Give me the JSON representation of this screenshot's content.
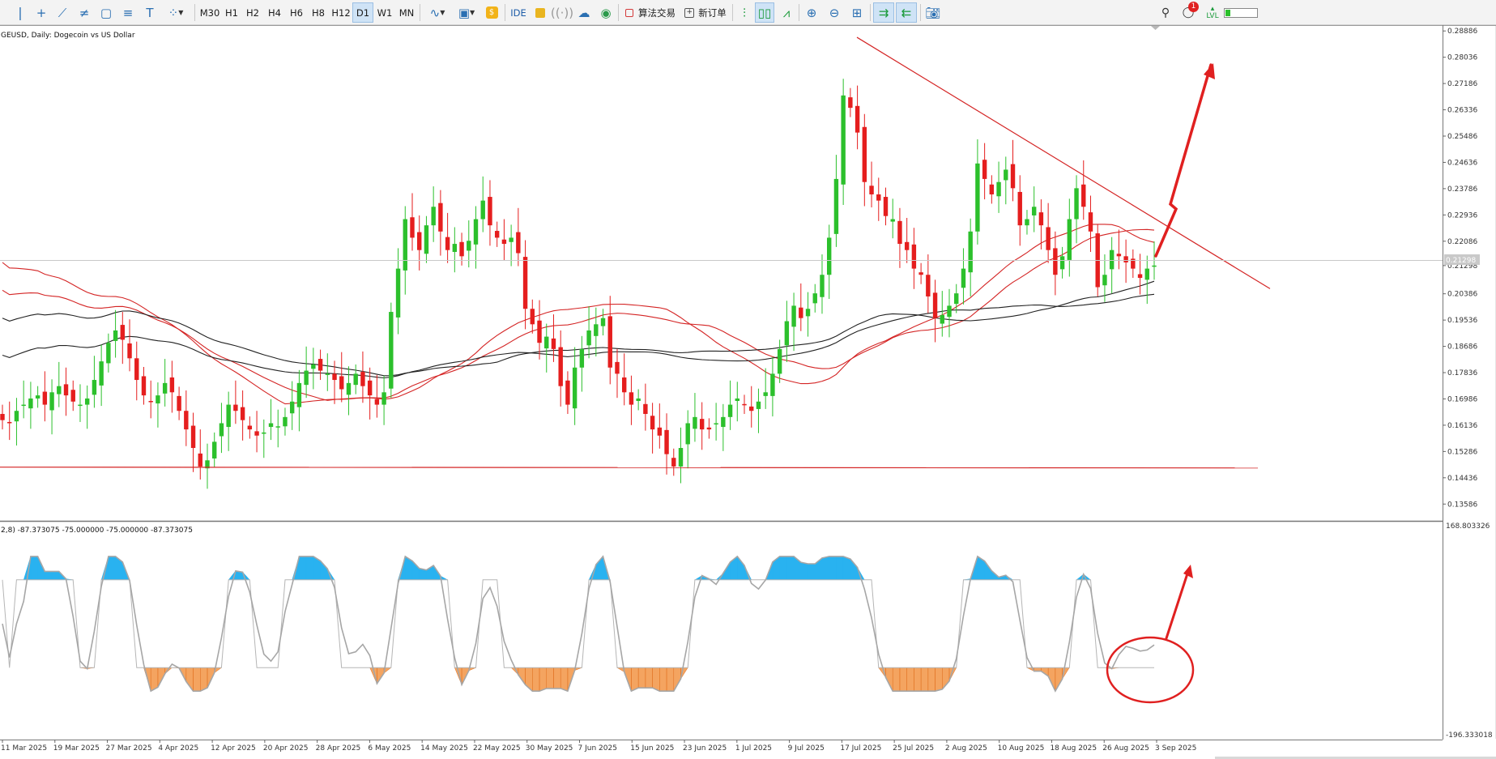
{
  "toolbar": {
    "timeframes": [
      "M30",
      "H1",
      "H2",
      "H4",
      "H6",
      "H8",
      "H12",
      "D1",
      "W1",
      "MN"
    ],
    "active_timeframe": "D1",
    "ide_label": "IDE",
    "algo_trading_label": "算法交易",
    "new_order_label": "新订单",
    "notification_count": "1",
    "icons": [
      "cursor-icon",
      "crosshair-icon",
      "trendline-icon",
      "channel-icon",
      "rectangle-icon",
      "fibonacci-icon",
      "text-icon",
      "shapes-icon",
      "chart-type-icon",
      "template-icon",
      "market-icon",
      "lock-icon",
      "signals-icon",
      "vps-icon",
      "bar-chart-icon",
      "candle-chart-icon",
      "line-chart-icon",
      "zoom-in-icon",
      "zoom-out-icon",
      "grid-icon",
      "autoscroll-icon",
      "shift-icon",
      "screenshot-icon",
      "search-icon",
      "notification-icon",
      "level-icon"
    ]
  },
  "chart": {
    "title": "GEUSD, Daily:  Dogecoin vs US Dollar",
    "current_price_label": "0.21298",
    "indicator_header": "2,8) -87.373075 -75.000000 -75.000000 -87.373075",
    "indicator_top_label": "168.803326",
    "indicator_bottom_label": "-196.333018",
    "colors": {
      "bull": "#2cc02c",
      "bear": "#e51e1e",
      "red_line": "#d42424",
      "blue_fill": "#29b2f0",
      "orange_fill": "#f4a460",
      "gray_line": "#a6a6a6"
    }
  },
  "chart_data": {
    "type": "candlestick",
    "symbol": "Dogecoin vs US Dollar",
    "price_axis": [
      "0.28886",
      "0.28036",
      "0.27186",
      "0.26336",
      "0.25486",
      "0.24636",
      "0.23786",
      "0.22936",
      "0.22086",
      "0.21298",
      "0.20386",
      "0.19536",
      "0.18686",
      "0.17836",
      "0.16986",
      "0.16136",
      "0.15286",
      "0.14436",
      "0.13586"
    ],
    "date_axis": [
      "11 Mar 2025",
      "19 Mar 2025",
      "27 Mar 2025",
      "4 Apr 2025",
      "12 Apr 2025",
      "20 Apr 2025",
      "28 Apr 2025",
      "6 May 2025",
      "14 May 2025",
      "22 May 2025",
      "30 May 2025",
      "7 Jun 2025",
      "15 Jun 2025",
      "23 Jun 2025",
      "1 Jul 2025",
      "9 Jul 2025",
      "17 Jul 2025",
      "25 Jul 2025",
      "2 Aug 2025",
      "10 Aug 2025",
      "18 Aug 2025",
      "26 Aug 2025",
      "3 Sep 2025"
    ],
    "ylim": [
      0.132,
      0.2897
    ],
    "last_price": 0.21298,
    "horizontal_support": 0.1478,
    "downtrend_line": {
      "from": [
        "17 Jul 2025",
        0.2868
      ],
      "to": [
        "after 3 Sep 2025",
        0.2055
      ]
    },
    "closes": [
      0.163,
      0.162,
      0.166,
      0.168,
      0.17,
      0.171,
      0.168,
      0.172,
      0.174,
      0.171,
      0.169,
      0.168,
      0.17,
      0.176,
      0.182,
      0.188,
      0.192,
      0.189,
      0.183,
      0.176,
      0.171,
      0.169,
      0.171,
      0.175,
      0.172,
      0.166,
      0.16,
      0.154,
      0.148,
      0.15,
      0.156,
      0.162,
      0.168,
      0.166,
      0.163,
      0.16,
      0.158,
      0.159,
      0.162,
      0.161,
      0.164,
      0.169,
      0.175,
      0.179,
      0.181,
      0.179,
      0.178,
      0.176,
      0.173,
      0.175,
      0.178,
      0.174,
      0.171,
      0.168,
      0.172,
      0.198,
      0.212,
      0.228,
      0.222,
      0.218,
      0.226,
      0.232,
      0.224,
      0.218,
      0.22,
      0.216,
      0.221,
      0.228,
      0.234,
      0.226,
      0.222,
      0.22,
      0.222,
      0.217,
      0.199,
      0.194,
      0.188,
      0.19,
      0.186,
      0.174,
      0.168,
      0.18,
      0.186,
      0.192,
      0.194,
      0.196,
      0.18,
      0.178,
      0.172,
      0.168,
      0.17,
      0.165,
      0.16,
      0.158,
      0.152,
      0.148,
      0.154,
      0.162,
      0.164,
      0.16,
      0.16,
      0.162,
      0.164,
      0.168,
      0.17,
      0.168,
      0.166,
      0.169,
      0.172,
      0.178,
      0.186,
      0.195,
      0.2,
      0.196,
      0.199,
      0.204,
      0.21,
      0.222,
      0.241,
      0.268,
      0.264,
      0.256,
      0.24,
      0.236,
      0.234,
      0.229,
      0.228,
      0.22,
      0.218,
      0.212,
      0.21,
      0.203,
      0.196,
      0.197,
      0.2,
      0.204,
      0.212,
      0.224,
      0.246,
      0.241,
      0.236,
      0.24,
      0.244,
      0.238,
      0.226,
      0.228,
      0.232,
      0.226,
      0.218,
      0.21,
      0.216,
      0.228,
      0.238,
      0.232,
      0.224,
      0.206,
      0.21,
      0.218,
      0.216,
      0.214,
      0.212,
      0.209,
      0.212,
      0.213
    ]
  },
  "indicator_data": {
    "type": "oscillator",
    "ylim": [
      -196.333018,
      168.803326
    ],
    "levels": [
      75.0,
      -75.0
    ],
    "last_values": [
      -87.373075,
      -75.0,
      -75.0,
      -87.373075
    ]
  }
}
